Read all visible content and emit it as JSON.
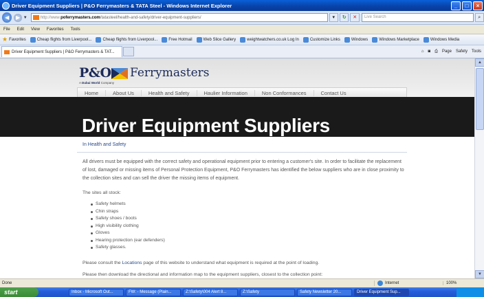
{
  "window": {
    "title": "Driver Equipment Suppliers | P&O Ferrymasters & TATA Steel - Windows Internet Explorer"
  },
  "address": {
    "prefix": "http://www.",
    "domain": "poferrymasters.com",
    "path": "/tatasteel/health-and-safety/driver-equipment-suppliers/",
    "search_placeholder": "Live Search"
  },
  "menu": [
    "File",
    "Edit",
    "View",
    "Favorites",
    "Tools"
  ],
  "favorites": {
    "label": "Favorites",
    "items": [
      "Cheap flights from Liverpool...",
      "Cheap flights from Liverpool...",
      "Free Hotmail",
      "Web Slice Gallery",
      "weightwatchers.co.uk Log In",
      "Customize Links",
      "Windows",
      "Windows Marketplace",
      "Windows Media"
    ]
  },
  "tab": {
    "label": "Driver Equipment Suppliers | P&O Ferrymasters & TAT..."
  },
  "commands": [
    "Page",
    "Safety",
    "Tools"
  ],
  "site": {
    "logo_po": "P&O",
    "logo_name": "Ferrymasters",
    "logo_tag_prefix": "A ",
    "logo_tag_bold": "Dubai World",
    "logo_tag_suffix": " Company",
    "nav": [
      "Home",
      "About Us",
      "Health and Safety",
      "Haulier Information",
      "Non Conformances",
      "Contact Us"
    ],
    "heading": "Driver Equipment Suppliers",
    "breadcrumb": "In Health and Safety",
    "intro": "All drivers must be equipped with the correct safety and operational equipment prior to entering a customer's site. In order to facilitate the replacement of lost, damaged or missing items of Personal Protection Equipment, P&O Ferrymasters has identified the below suppliers who are in close proximity to the collection sites and can sell the driver the missing items of equipment.",
    "stock_label": "The sites all stock:",
    "stock_items": [
      "Safety helmets",
      "Chin straps",
      "Safety shoes / boots",
      "High visibility clothing",
      "Gloves",
      "Hearing protection (ear defenders)",
      "Safety glasses."
    ],
    "consult_pre": "Please consult the ",
    "consult_link": "Locations",
    "consult_post": " page of this website to understand what equipment is required at the point of loading.",
    "download": "Please then download the directional and information map to the equipment suppliers, closest to the collection point:"
  },
  "status": {
    "text": "Done",
    "zone": "Internet",
    "zoom": "100%"
  },
  "taskbar": {
    "start": "start",
    "tasks": [
      "Inbox - Microsoft Out...",
      "FW: - Message (Plain...",
      "Z:\\Safety\\004 Alert 8...",
      "Z:\\Safety",
      "Safety Newsletter 20...",
      "Driver Equipment Sup..."
    ]
  },
  "colors": {
    "hero_bg": "#1a1a1a",
    "brand_navy": "#1b2a5a",
    "link": "#2a4a8a"
  }
}
